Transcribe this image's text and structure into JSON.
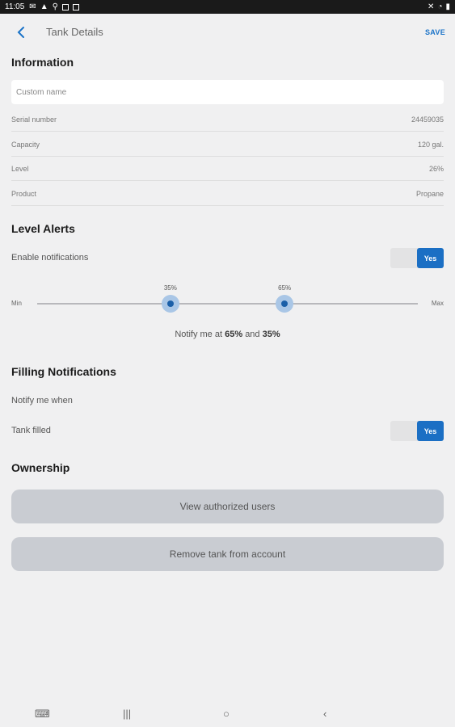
{
  "status": {
    "time": "11:05"
  },
  "header": {
    "title": "Tank Details",
    "save_label": "SAVE"
  },
  "information": {
    "heading": "Information",
    "custom_name_placeholder": "Custom name",
    "rows": [
      {
        "label": "Serial number",
        "value": "24459035"
      },
      {
        "label": "Capacity",
        "value": "120 gal."
      },
      {
        "label": "Level",
        "value": "26%"
      },
      {
        "label": "Product",
        "value": "Propane"
      }
    ]
  },
  "level_alerts": {
    "heading": "Level Alerts",
    "enable_label": "Enable notifications",
    "toggle_on_label": "Yes",
    "enabled": true,
    "slider": {
      "min_label": "Min",
      "max_label": "Max",
      "low_value": 35,
      "high_value": 65,
      "low_label": "35%",
      "high_label": "65%"
    },
    "summary_prefix": "Notify me at",
    "summary_high": "65%",
    "summary_and": "and",
    "summary_low": "35%"
  },
  "filling": {
    "heading": "Filling Notifications",
    "notify_when_label": "Notify me when",
    "tank_filled_label": "Tank filled",
    "toggle_on_label": "Yes",
    "enabled": true
  },
  "ownership": {
    "heading": "Ownership",
    "view_users_label": "View authorized users",
    "remove_tank_label": "Remove tank from account"
  }
}
